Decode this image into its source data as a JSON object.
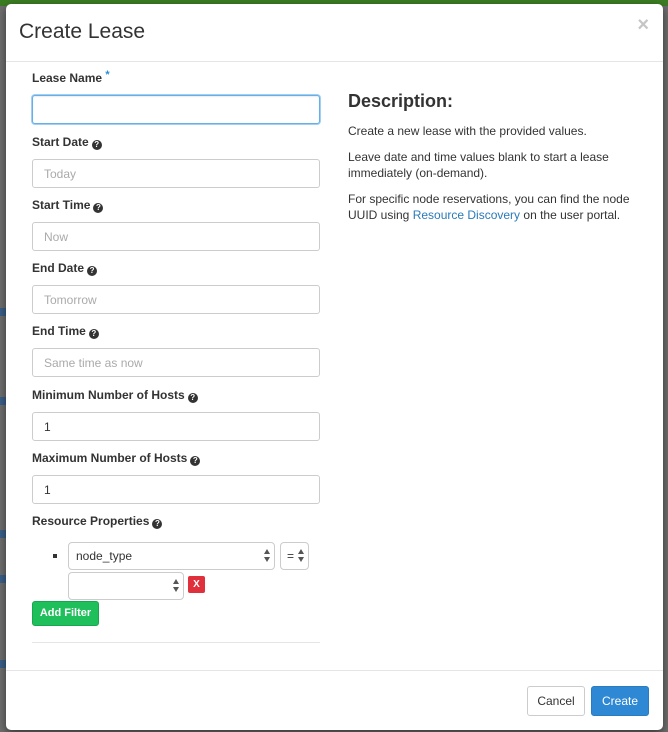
{
  "modal": {
    "title": "Create Lease",
    "close_glyph": "×"
  },
  "form": {
    "lease_name": {
      "label": "Lease Name",
      "required_mark": "*",
      "value": "",
      "placeholder": ""
    },
    "start_date": {
      "label": "Start Date",
      "placeholder": "Today",
      "value": ""
    },
    "start_time": {
      "label": "Start Time",
      "placeholder": "Now",
      "value": ""
    },
    "end_date": {
      "label": "End Date",
      "placeholder": "Tomorrow",
      "value": ""
    },
    "end_time": {
      "label": "End Time",
      "placeholder": "Same time as now",
      "value": ""
    },
    "min_hosts": {
      "label": "Minimum Number of Hosts",
      "value": "1"
    },
    "max_hosts": {
      "label": "Maximum Number of Hosts",
      "value": "1"
    },
    "resource_properties": {
      "label": "Resource Properties",
      "filter": {
        "property": "node_type",
        "operator": "=",
        "value": ""
      },
      "remove_label": "X",
      "add_filter_label": "Add Filter"
    },
    "help_glyph": "?"
  },
  "description": {
    "title": "Description:",
    "p1": "Create a new lease with the provided values.",
    "p2": "Leave date and time values blank to start a lease immediately (on-demand).",
    "p3_before": "For specific node reservations, you can find the node UUID using ",
    "p3_link": "Resource Discovery",
    "p3_after": " on the user portal."
  },
  "footer": {
    "cancel_label": "Cancel",
    "create_label": "Create"
  },
  "colors": {
    "primary": "#2f88d3",
    "success": "#1fbf5b",
    "danger": "#e0303b",
    "link": "#2a7ab8"
  }
}
